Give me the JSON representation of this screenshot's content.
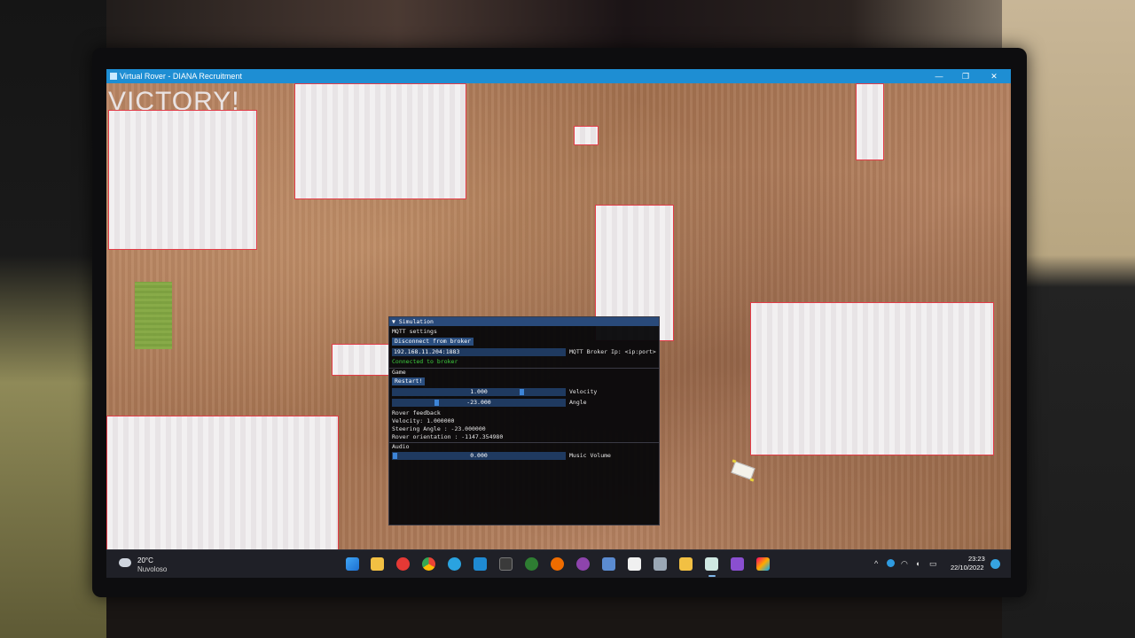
{
  "window": {
    "title": "Virtual Rover - DIANA Recruitment",
    "min_glyph": "—",
    "max_glyph": "❐",
    "close_glyph": "✕"
  },
  "game": {
    "victory_text": "VICTORY!"
  },
  "simulation": {
    "header": "▼ Simulation",
    "mqtt": {
      "section": "MQTT settings",
      "disconnect_button": "Disconnect from broker",
      "broker_value": "192.168.11.204:1883",
      "broker_label": "MQTT Broker Ip: <ip:port>",
      "status": "Connected to broker"
    },
    "game": {
      "section": "Game",
      "restart_button": "Restart!",
      "velocity_value": "1.000",
      "velocity_label": "Velocity",
      "angle_value": "-23.000",
      "angle_label": "Angle"
    },
    "feedback": {
      "section": "Rover feedback",
      "velocity": "Velocity: 1.000000",
      "steering": "Steering Angle : -23.000000",
      "orientation": "Rover orientation : -1147.354980"
    },
    "audio": {
      "section": "Audio",
      "volume_value": "0.000",
      "volume_label": "Music Volume"
    }
  },
  "taskbar": {
    "weather_temp": "20°C",
    "weather_desc": "Nuvoloso",
    "time": "23:23",
    "date": "22/10/2022",
    "tray_chevron": "^"
  },
  "colors": {
    "titlebar": "#1e8ed3",
    "obstacle_border": "#e23c48",
    "imgui_accent": "#2a4e7f",
    "connected": "#3ecf3e"
  }
}
